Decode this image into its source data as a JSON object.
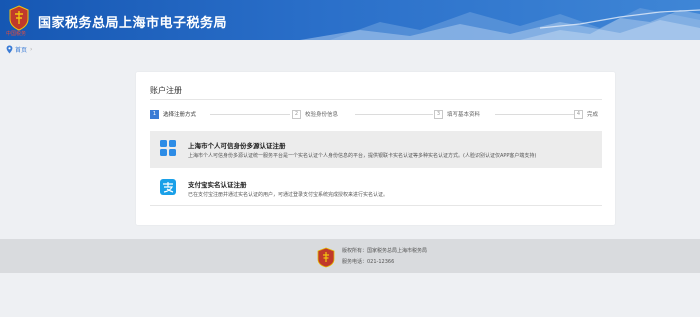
{
  "header": {
    "site_title": "国家税务总局上海市电子税务局",
    "logo_caption": "中国税务"
  },
  "breadcrumb": {
    "home": "首页",
    "separator": "›"
  },
  "card": {
    "title": "账户注册",
    "steps": [
      {
        "num": "1",
        "label": "选择注册方式",
        "active": true
      },
      {
        "num": "2",
        "label": "校验身份信息",
        "active": false
      },
      {
        "num": "3",
        "label": "填写基本资料",
        "active": false
      },
      {
        "num": "4",
        "label": "完成",
        "active": false
      }
    ],
    "options": [
      {
        "icon": "grid-apps-icon",
        "title": "上海市个人可信身份多源认证注册",
        "desc": "上海市个人可信身份多源认证统一服务平台是一个实名认证个人身份信息的平台，提供银联卡实名认证等多种实名认证方式。(人脸识别认证仅APP客户端支持)"
      },
      {
        "icon": "alipay-icon",
        "title": "支付宝实名认证注册",
        "desc": "已在支付宝注册并通过实名认证的用户，可通过登录支付宝系统完成授权来进行实名认证。"
      }
    ]
  },
  "footer": {
    "copyright": "版权所有：国家税务总局上海市税务局",
    "hotline": "服务电话：021-12366"
  },
  "colors": {
    "header_blue": "#1f5fb8",
    "accent": "#3a7bd5",
    "alipay": "#1aa0e8",
    "footer_bg": "#d9dbde"
  }
}
